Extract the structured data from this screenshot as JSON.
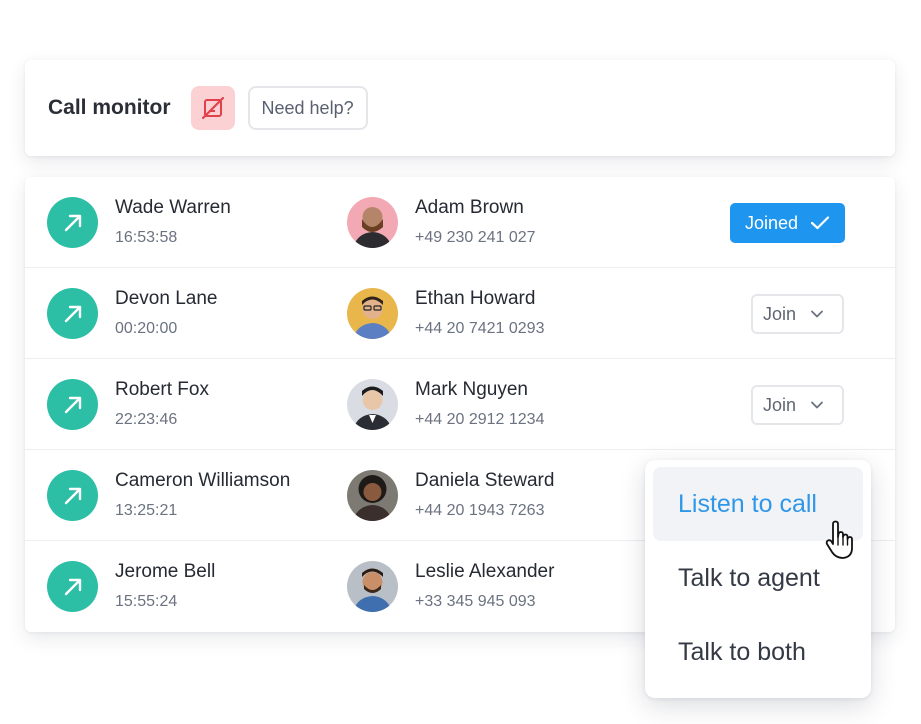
{
  "header": {
    "title": "Call monitor",
    "mic_icon": "mic-off-icon",
    "help_label": "Need help?",
    "accent_color": "#fbd1d3"
  },
  "calls": [
    {
      "caller": "Wade Warren",
      "time": "16:53:58",
      "agent": "Adam Brown",
      "phone": "+49 230 241 027",
      "action": "Joined",
      "avatar_bg": "#f3a9b4"
    },
    {
      "caller": "Devon Lane",
      "time": "00:20:00",
      "agent": "Ethan Howard",
      "phone": "+44 20 7421 0293",
      "action": "Join",
      "avatar_bg": "#e8b64a"
    },
    {
      "caller": "Robert Fox",
      "time": "22:23:46",
      "agent": "Mark Nguyen",
      "phone": "+44 20 2912 1234",
      "action": "Join",
      "avatar_bg": "#d9dde3"
    },
    {
      "caller": "Cameron Williamson",
      "time": "13:25:21",
      "agent": "Daniela Steward",
      "phone": "+44 20 1943 7263",
      "action": "",
      "avatar_bg": "#7d7a73"
    },
    {
      "caller": "Jerome Bell",
      "time": "15:55:24",
      "agent": "Leslie Alexander",
      "phone": "+33 345 945 093",
      "action": "",
      "avatar_bg": "#b9bfc6"
    }
  ],
  "colors": {
    "call_icon": "#2cbfa6",
    "joined_button": "#1e96f0",
    "active_menu_text": "#2f97e8"
  },
  "menu": {
    "items": [
      "Listen to call",
      "Talk to agent",
      "Talk to both"
    ],
    "active": "Listen to call"
  }
}
